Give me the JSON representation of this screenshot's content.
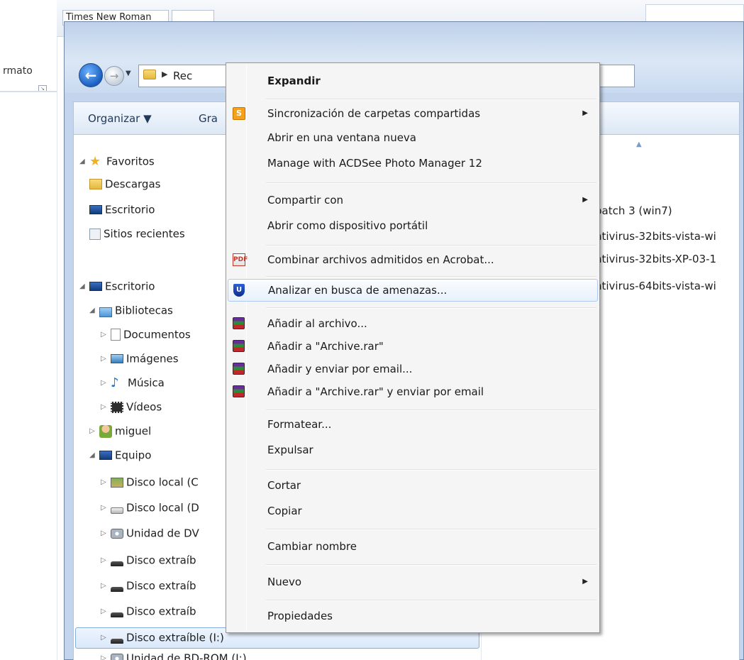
{
  "word": {
    "ribbon_group_label": "rmato",
    "font_name": "Times New Roman"
  },
  "explorer": {
    "address_crumb": "Rec",
    "commandbar": {
      "organize": "Organizar ▼",
      "share": "Gra"
    },
    "nav": {
      "favorites": "Favoritos",
      "downloads": "Descargas",
      "desktop_fav": "Escritorio",
      "recent": "Sitios recientes",
      "desktop": "Escritorio",
      "libraries": "Bibliotecas",
      "documents": "Documentos",
      "images": "Imágenes",
      "music": "Música",
      "videos": "Vídeos",
      "user": "miguel",
      "computer": "Equipo",
      "disk_c": "Disco local (C",
      "disk_d": "Disco local (D",
      "dvd": "Unidad de DV",
      "removable_1": "Disco extraíb",
      "removable_2": "Disco extraíb",
      "removable_3": "Disco extraíb",
      "removable_selected": "Disco extraíble (I:)",
      "bdrom": "Unidad de BD-ROM (J:)"
    },
    "files": [
      "patch 3 (win7)",
      "ntivirus-32bits-vista-wi",
      "ntivirus-32bits-XP-03-1",
      "ntivirus-64bits-vista-wi"
    ]
  },
  "context_menu": {
    "expand": "Expandir",
    "sync": "Sincronización de carpetas compartidas",
    "open_new_window": "Abrir en una ventana nueva",
    "acdsee": "Manage with ACDSee Photo Manager 12",
    "share_with": "Compartir con",
    "open_portable": "Abrir como dispositivo portátil",
    "acrobat": "Combinar archivos admitidos en Acrobat...",
    "scan": "Analizar en busca de amenazas...",
    "add_archive": "Añadir al archivo...",
    "add_rar": "Añadir a \"Archive.rar\"",
    "add_email": "Añadir y enviar por email...",
    "add_rar_email": "Añadir a \"Archive.rar\" y enviar por email",
    "format": "Formatear...",
    "eject": "Expulsar",
    "cut": "Cortar",
    "copy": "Copiar",
    "rename": "Cambiar nombre",
    "new": "Nuevo",
    "properties": "Propiedades"
  },
  "icons": {
    "acrobat_glyph": "PDF",
    "sync_glyph": "S",
    "shield_glyph": "U"
  }
}
